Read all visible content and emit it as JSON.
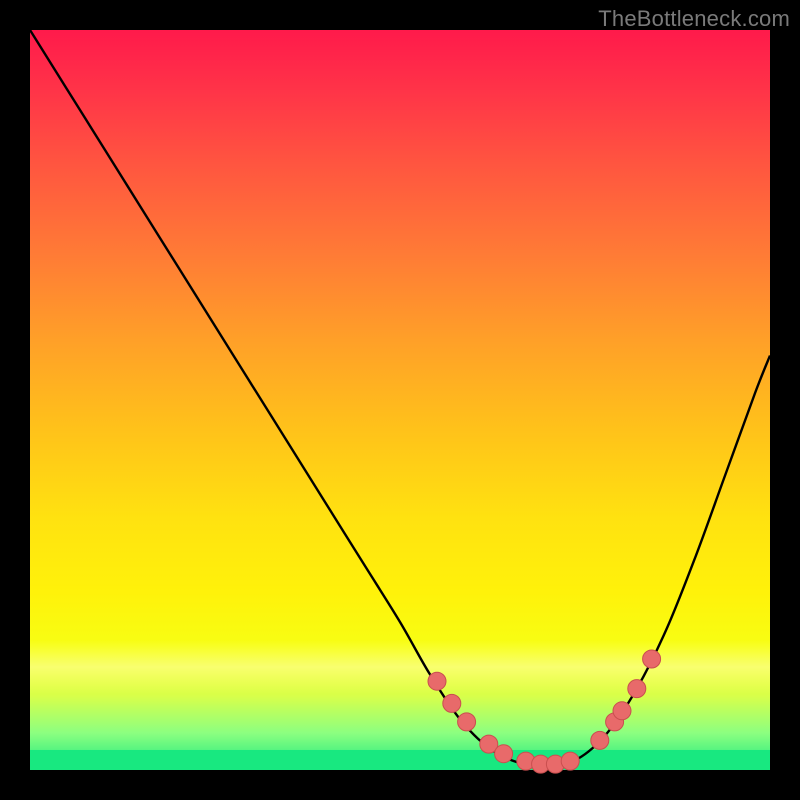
{
  "watermark": "TheBottleneck.com",
  "colors": {
    "background": "#000000",
    "curve_stroke": "#000000",
    "dot_fill": "#e86a6a",
    "dot_stroke": "#c94f4f"
  },
  "chart_data": {
    "type": "line",
    "title": "",
    "xlabel": "",
    "ylabel": "",
    "xlim": [
      0,
      100
    ],
    "ylim": [
      0,
      100
    ],
    "grid": false,
    "legend": false,
    "series": [
      {
        "name": "curve",
        "x": [
          0,
          5,
          10,
          15,
          20,
          25,
          30,
          35,
          40,
          45,
          50,
          54,
          58,
          62,
          66,
          70,
          74,
          78,
          82,
          86,
          90,
          94,
          98,
          100
        ],
        "y": [
          100,
          92,
          84,
          76,
          68,
          60,
          52,
          44,
          36,
          28,
          20,
          13,
          7,
          3,
          1,
          0.5,
          1.5,
          5,
          11,
          19,
          29,
          40,
          51,
          56
        ]
      }
    ],
    "dots": {
      "name": "highlighted-points",
      "x": [
        55,
        57,
        59,
        62,
        64,
        67,
        69,
        71,
        73,
        77,
        79,
        80,
        82,
        84
      ],
      "y": [
        12,
        9,
        6.5,
        3.5,
        2.2,
        1.2,
        0.8,
        0.8,
        1.2,
        4,
        6.5,
        8,
        11,
        15
      ]
    }
  }
}
